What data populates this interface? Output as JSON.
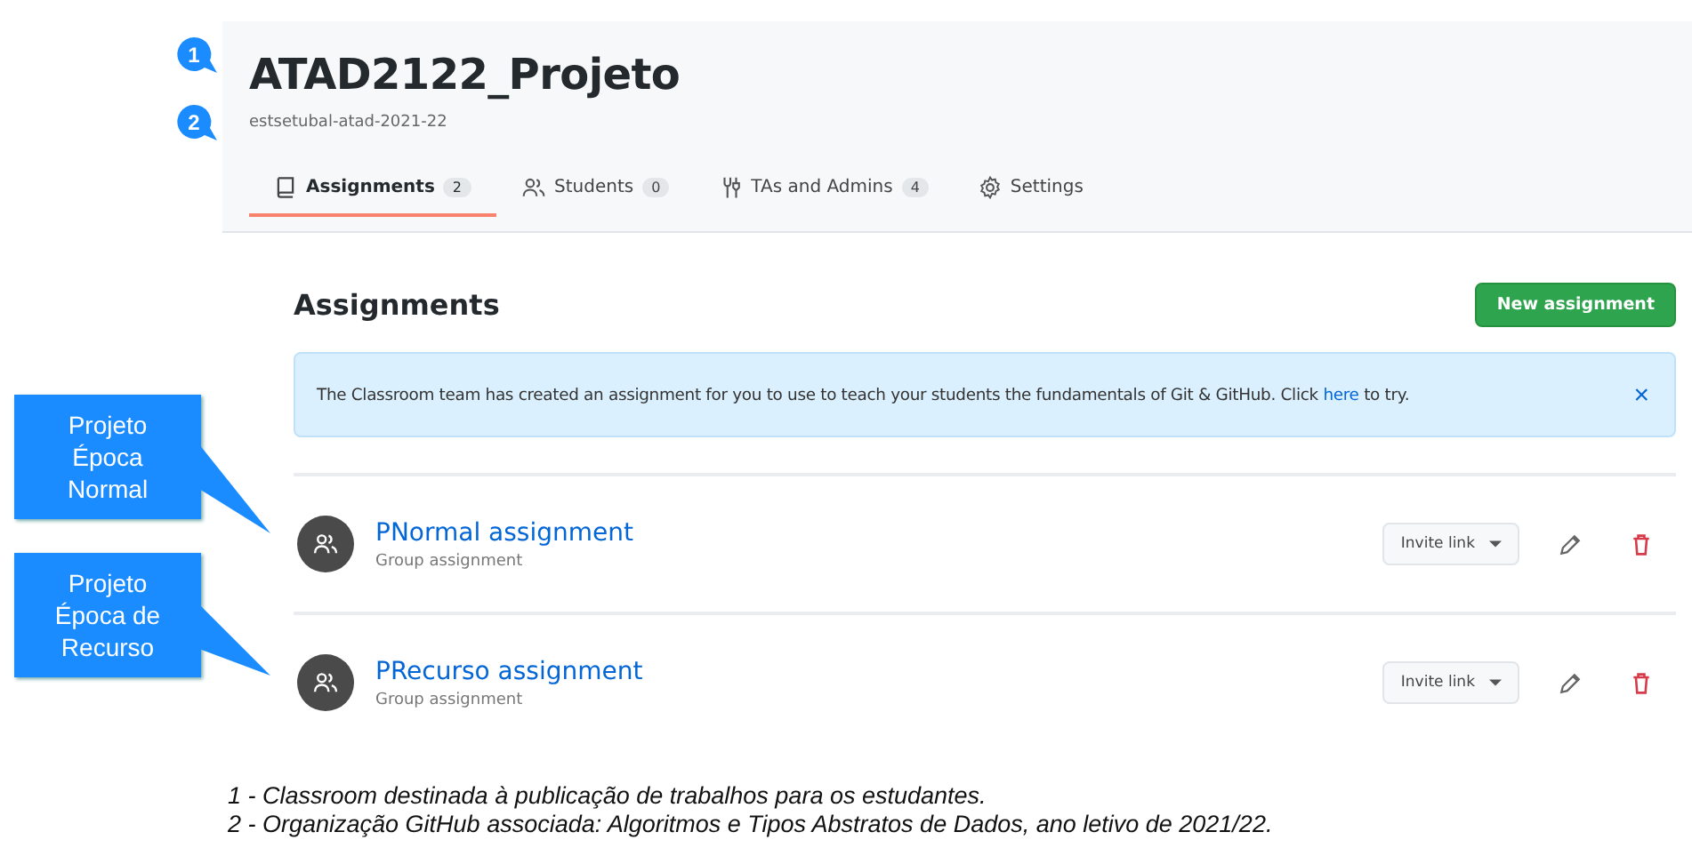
{
  "annotations": {
    "markers": [
      {
        "number": "1"
      },
      {
        "number": "2"
      }
    ],
    "callouts": [
      {
        "text": "Projeto Época Normal"
      },
      {
        "text": "Projeto Época de Recurso"
      }
    ]
  },
  "classroom": {
    "title": "ATAD2122_Projeto",
    "organization": "estsetubal-atad-2021-22",
    "tabs": [
      {
        "kind": "assignments",
        "label": "Assignments",
        "count": "2",
        "selected": true
      },
      {
        "kind": "students",
        "label": "Students",
        "count": "0",
        "selected": false
      },
      {
        "kind": "staff",
        "label": "TAs and Admins",
        "count": "4",
        "selected": false
      },
      {
        "kind": "settings",
        "label": "Settings",
        "selected": false
      }
    ]
  },
  "assignments": {
    "heading": "Assignments",
    "new_button": "New assignment",
    "banner": {
      "before": "The Classroom team has created an assignment for you to use to teach your students the fundamentals of Git & GitHub. Click ",
      "link": "here",
      "after": " to try.",
      "close": "×"
    },
    "items": [
      {
        "title": "PNormal assignment",
        "type": "Group assignment",
        "invite": "Invite link"
      },
      {
        "title": "PRecurso assignment",
        "type": "Group assignment",
        "invite": "Invite link"
      }
    ]
  },
  "footnotes": [
    "1 - Classroom destinada à publicação de trabalhos para os estudantes.",
    "2 - Organização GitHub associada: Algoritmos e Tipos Abstratos de Dados, ano letivo de 2021/22."
  ]
}
